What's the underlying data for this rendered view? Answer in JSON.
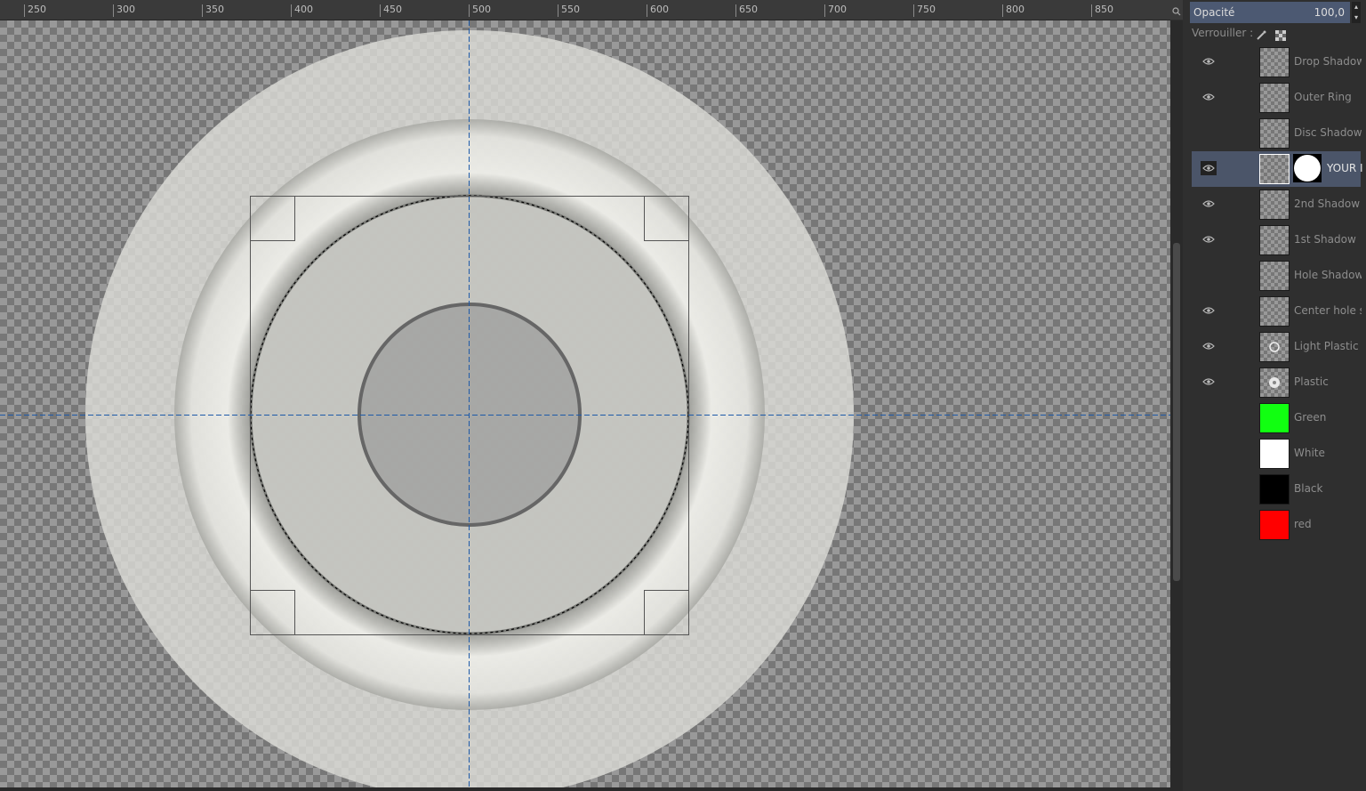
{
  "ruler": {
    "ticks": [
      "250",
      "300",
      "350",
      "400",
      "450",
      "500",
      "550",
      "600",
      "650",
      "700",
      "750",
      "800",
      "850"
    ]
  },
  "canvas": {
    "icons": [
      "navigate-icon"
    ]
  },
  "panel": {
    "opacity_label": "Opacité",
    "opacity_value": "100,0",
    "lock_label": "Verrouiller :",
    "lock_icons": [
      "paintbrush-icon",
      "alpha-lock-icon"
    ]
  },
  "layers": [
    {
      "name": "Drop Shadow",
      "visible": true,
      "thumb": "transparent"
    },
    {
      "name": "Outer Ring",
      "visible": true,
      "thumb": "transparent"
    },
    {
      "name": "Disc Shadow",
      "visible": false,
      "thumb": "transparent"
    },
    {
      "name": "YOUR I",
      "visible": true,
      "thumb": "transparent",
      "active": true,
      "has_mask": true
    },
    {
      "name": "2nd Shadow",
      "visible": true,
      "thumb": "transparent"
    },
    {
      "name": "1st Shadow",
      "visible": true,
      "thumb": "transparent"
    },
    {
      "name": "Hole Shadow",
      "visible": false,
      "thumb": "transparent"
    },
    {
      "name": "Center hole s",
      "visible": true,
      "thumb": "transparent"
    },
    {
      "name": "Light Plastic",
      "visible": true,
      "thumb": "ring"
    },
    {
      "name": "Plastic",
      "visible": true,
      "thumb": "disc"
    },
    {
      "name": "Green",
      "visible": false,
      "thumb": "#11ff11"
    },
    {
      "name": "White",
      "visible": false,
      "thumb": "#ffffff"
    },
    {
      "name": "Black",
      "visible": false,
      "thumb": "#000000"
    },
    {
      "name": "red",
      "visible": false,
      "thumb": "#ff0000"
    }
  ],
  "colors": {
    "selection_panel": "#4c5972",
    "active_layer": "#4b5569",
    "guide": "#1e5aa8"
  }
}
